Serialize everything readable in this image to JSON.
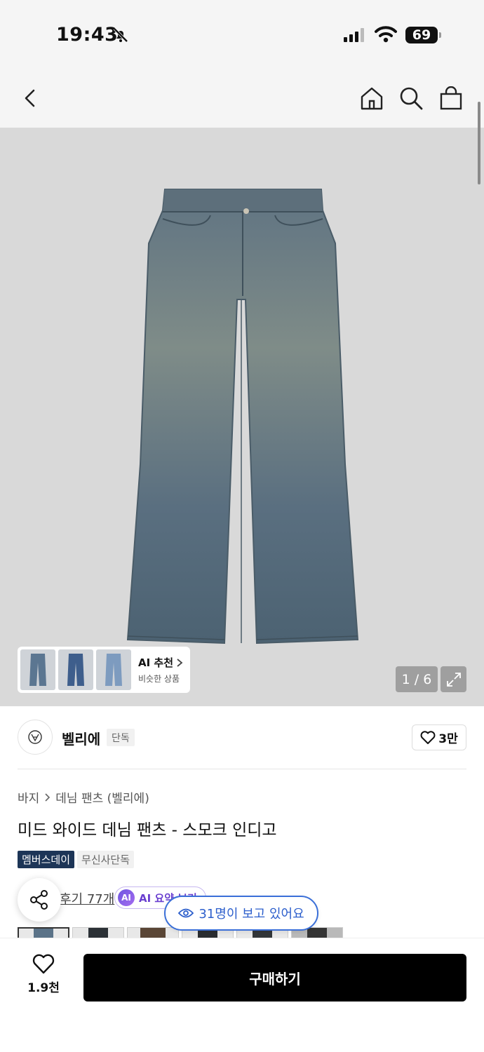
{
  "status_bar": {
    "time": "19:43",
    "battery": "69"
  },
  "nav": {
    "icons": [
      "back-arrow-icon",
      "home-icon",
      "search-icon",
      "shopping-bag-icon"
    ]
  },
  "gallery": {
    "ai_recommend_title": "AI 추천",
    "ai_recommend_sub": "비슷한 상품",
    "page_counter": "1 / 6"
  },
  "brand": {
    "name": "벨리에",
    "badge": "단독",
    "like_count": "3만"
  },
  "breadcrumb": {
    "category": "바지",
    "subcategory": "데님 팬츠 (벨리에)"
  },
  "product": {
    "title": "미드 와이드 데님 팬츠 - 스모크 인디고",
    "tags": [
      "멤버스데이",
      "무신사단독"
    ],
    "review_link": "후기 77개",
    "ai_summary": "AI 요약 보기",
    "viewers": "31명이 보고 있어요"
  },
  "bottom_bar": {
    "wish_count": "1.9천",
    "buy_label": "구매하기"
  },
  "colors": {
    "accent_blue": "#2d5fcc",
    "tag_dark": "#1d3557",
    "ai_purple": "#6a3fd0"
  }
}
